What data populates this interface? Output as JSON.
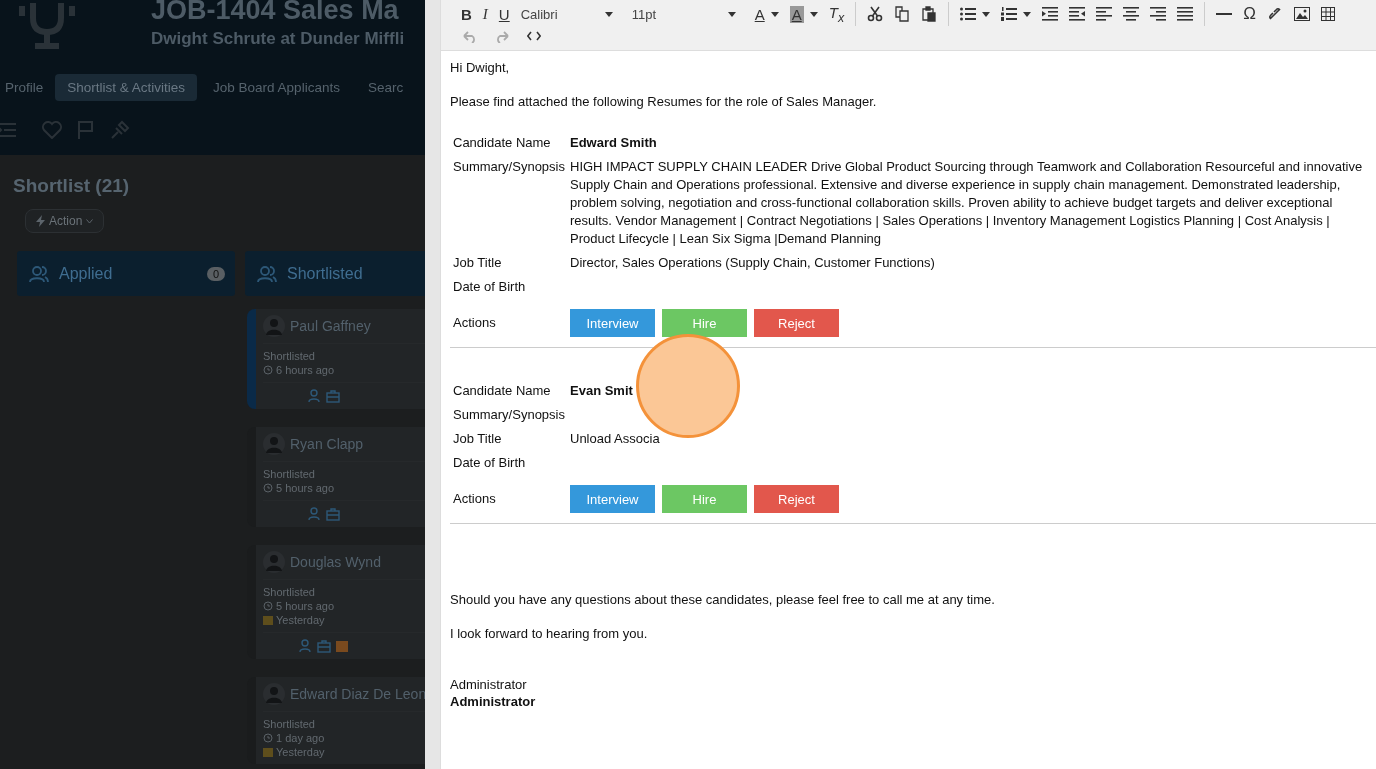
{
  "app": {
    "title": "JOB-1404 Sales Ma",
    "subtitle": "Dwight Schrute at Dunder Miffli",
    "tabs": [
      {
        "label": "Profile",
        "selected": false
      },
      {
        "label": "Shortlist & Activities",
        "selected": true
      },
      {
        "label": "Job Board Applicants",
        "selected": false
      },
      {
        "label": "Searc",
        "selected": false
      }
    ]
  },
  "shortlist": {
    "heading": "Shortlist (21)",
    "action": "Action",
    "columns": [
      {
        "title": "Applied",
        "count": "0"
      },
      {
        "title": "Shortlisted",
        "cards": [
          {
            "name": "Paul Gaffney",
            "status": "Shortlisted",
            "time": "6 hours ago",
            "selected": true,
            "reminder": false
          },
          {
            "name": "Ryan Clapp",
            "status": "Shortlisted",
            "time": "5 hours ago",
            "selected": false,
            "reminder": false
          },
          {
            "name": "Douglas Wynd",
            "status": "Shortlisted",
            "time": "5 hours ago",
            "due": "Yesterday",
            "selected": false,
            "reminder": true
          },
          {
            "name": "Edward Diaz De Leon",
            "status": "Shortlisted",
            "time": "1 day ago",
            "due": "Yesterday",
            "selected": false
          }
        ]
      }
    ]
  },
  "editor": {
    "toolbar": {
      "bold": "B",
      "italic": "I",
      "underline": "U",
      "font": "Calibri",
      "size": "11pt",
      "text_color": "A",
      "highlight": "A",
      "clear_format": "T$_{x}$",
      "special_char": "Ω"
    },
    "greeting": "Hi Dwight,",
    "intro": "Please find attached the following Resumes for the role of Sales Manager.",
    "candidates": [
      {
        "name_label": "Candidate Name",
        "name": "Edward Smith",
        "fields": [
          {
            "label": "Summary/Synopsis",
            "value": "HIGH IMPACT SUPPLY CHAIN LEADER Drive Global Product Sourcing through Teamwork and Collaboration Resourceful and innovative Supply Chain and Operations professional. Extensive and diverse experience in supply chain management. Demonstrated leadership, problem solving, negotiation and cross-functional collaboration skills. Proven ability to achieve budget targets and deliver exceptional results. Vendor Management | Contract Negotiations | Sales Operations | Inventory Management Logistics Planning | Cost Analysis | Product Lifecycle | Lean Six Sigma |Demand Planning"
          },
          {
            "label": "Job Title",
            "value": "Director, Sales Operations (Supply Chain, Customer Functions)"
          },
          {
            "label": "Date of Birth"
          }
        ],
        "actions_label": "Actions",
        "actions": [
          {
            "label": "Interview",
            "color": "#3498db"
          },
          {
            "label": "Hire",
            "color": "#6cc763"
          },
          {
            "label": "Reject",
            "color": "#e2574c"
          }
        ]
      },
      {
        "name_label": "Candidate Name",
        "name": "Evan Smit",
        "fields": [
          {
            "label": "Summary/Synopsis"
          },
          {
            "label": "Job Title",
            "value": "Unload Associa"
          },
          {
            "label": "Date of Birth"
          }
        ],
        "actions_label": "Actions",
        "actions": [
          {
            "label": "Interview",
            "color": "#3498db"
          },
          {
            "label": "Hire",
            "color": "#6cc763"
          },
          {
            "label": "Reject",
            "color": "#e2574c"
          }
        ]
      }
    ],
    "closing": [
      "Should you have any questions about these candidates, please feel free to call me at any time.",
      "I look forward to hearing from you."
    ],
    "signature": {
      "line": "Administrator",
      "name": "Administrator"
    }
  }
}
